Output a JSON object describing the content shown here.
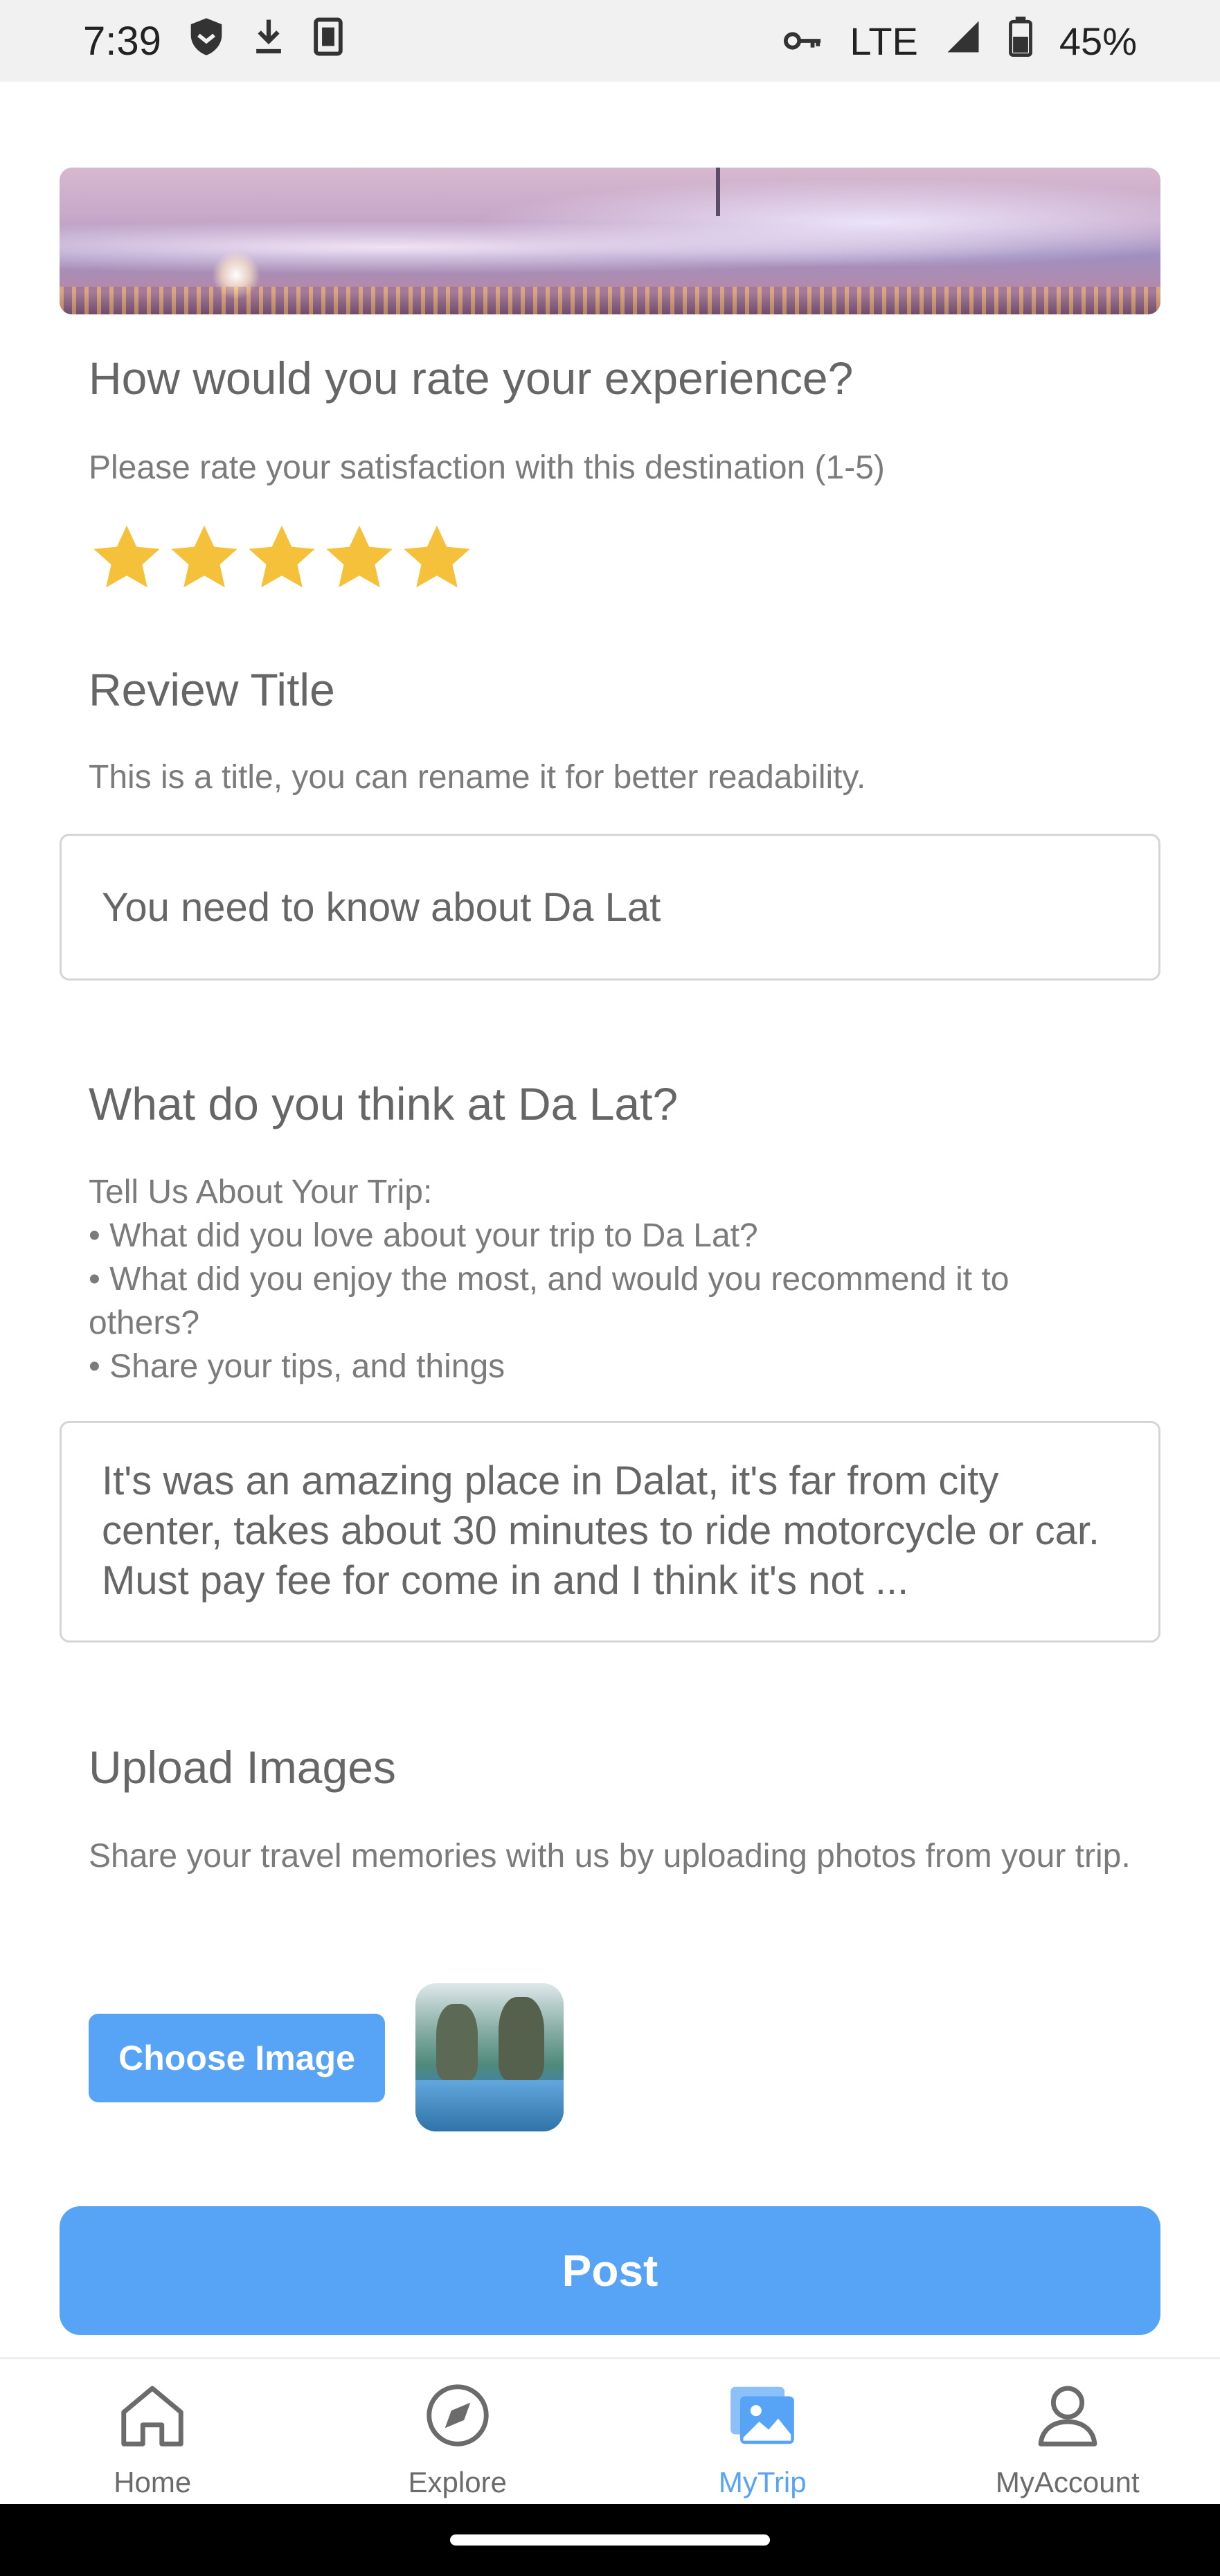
{
  "status_bar": {
    "time": "7:39",
    "network": "LTE",
    "battery": "45%",
    "icons_left": [
      "shield-icon",
      "download-icon",
      "sim-card-icon"
    ],
    "icons_right": [
      "vpn-key-icon",
      "signal-icon",
      "battery-icon"
    ]
  },
  "rating": {
    "title": "How would you rate your experience?",
    "subtitle": "Please rate your satisfaction with this destination (1-5)",
    "value": 5,
    "max": 5,
    "star_color": "#f5c13b"
  },
  "review_title": {
    "title": "Review Title",
    "subtitle": "This is a title, you can rename it for better readability.",
    "value": "You need to know about Da Lat"
  },
  "review_body": {
    "title": "What do you think at Da Lat?",
    "prompt_heading": "Tell Us About Your Trip:",
    "prompts": [
      "• What did you love about your trip to Da Lat?",
      "• What did you enjoy the most, and would you recommend it to others?",
      "• Share your tips, and things"
    ],
    "value": "It's was an amazing place in Dalat, it's far from city center, takes about 30 minutes to ride motorcycle or car. Must pay fee for come in and I think it's not ..."
  },
  "upload": {
    "title": "Upload Images",
    "subtitle": "Share your travel memories with us by uploading photos from your trip.",
    "choose_label": "Choose Image"
  },
  "post_label": "Post",
  "accent_color": "#57a3f5",
  "nav": {
    "items": [
      {
        "label": "Home",
        "icon": "home-icon",
        "active": false
      },
      {
        "label": "Explore",
        "icon": "compass-icon",
        "active": false
      },
      {
        "label": "MyTrip",
        "icon": "gallery-icon",
        "active": true
      },
      {
        "label": "MyAccount",
        "icon": "user-icon",
        "active": false
      }
    ]
  }
}
